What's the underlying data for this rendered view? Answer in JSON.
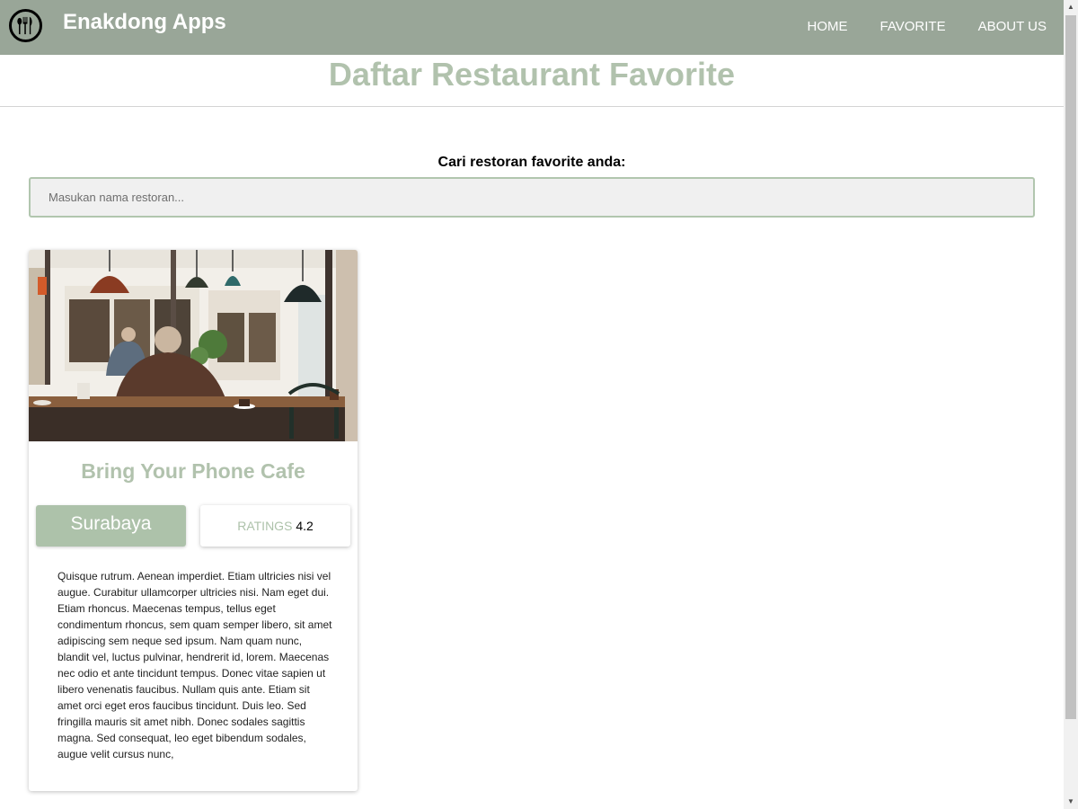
{
  "header": {
    "brand": "Enakdong Apps",
    "logo_icon": "utensils-icon",
    "nav": [
      {
        "label": "HOME"
      },
      {
        "label": "FAVORITE"
      },
      {
        "label": "ABOUT US"
      }
    ]
  },
  "page": {
    "title": "Daftar Restaurant Favorite"
  },
  "search": {
    "label": "Cari restoran favorite anda:",
    "placeholder": "Masukan nama restoran...",
    "value": ""
  },
  "restaurants": [
    {
      "name": "Bring Your Phone Cafe",
      "city": "Surabaya",
      "rating_label": "RATINGS",
      "rating": "4.2",
      "description": "Quisque rutrum. Aenean imperdiet. Etiam ultricies nisi vel augue. Curabitur ullamcorper ultricies nisi. Nam eget dui. Etiam rhoncus. Maecenas tempus, tellus eget condimentum rhoncus, sem quam semper libero, sit amet adipiscing sem neque sed ipsum. Nam quam nunc, blandit vel, luctus pulvinar, hendrerit id, lorem. Maecenas nec odio et ante tincidunt tempus. Donec vitae sapien ut libero venenatis faucibus. Nullam quis ante. Etiam sit amet orci eget eros faucibus tincidunt. Duis leo. Sed fringilla mauris sit amet nibh. Donec sodales sagittis magna. Sed consequat, leo eget bibendum sodales, augue velit cursus nunc,"
    }
  ],
  "colors": {
    "navbar": "#99a698",
    "accent": "#b1c2ad",
    "badge": "#adc2aa"
  }
}
